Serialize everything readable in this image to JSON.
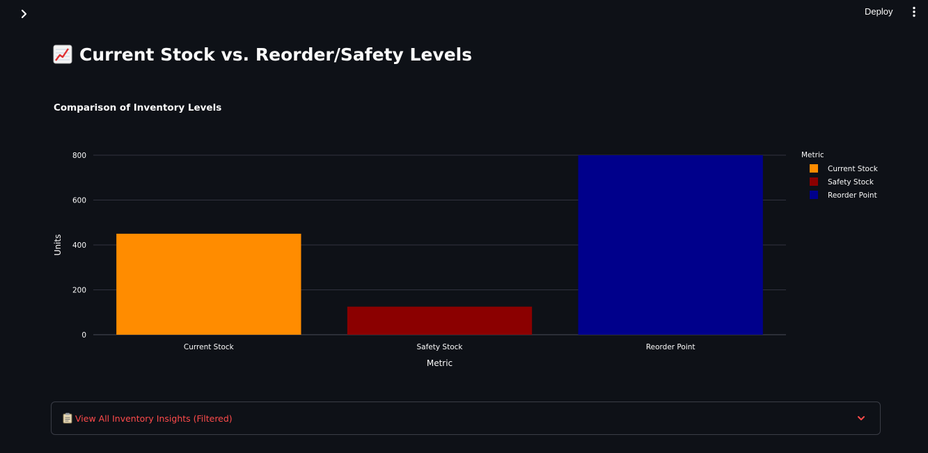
{
  "header": {
    "deploy_label": "Deploy"
  },
  "page": {
    "title": "Current Stock vs. Reorder/Safety Levels",
    "chart_title": "Comparison of Inventory Levels"
  },
  "chart_data": {
    "type": "bar",
    "title": "Comparison of Inventory Levels",
    "xlabel": "Metric",
    "ylabel": "Units",
    "categories": [
      "Current Stock",
      "Safety Stock",
      "Reorder Point"
    ],
    "values": [
      450,
      125,
      800
    ],
    "colors": [
      "#ff8c00",
      "#8b0000",
      "#00008b"
    ],
    "ylim": [
      0,
      800
    ],
    "yticks": [
      0,
      200,
      400,
      600,
      800
    ],
    "grid": true,
    "legend": {
      "title": "Metric",
      "placement": "right",
      "entries": [
        "Current Stock",
        "Safety Stock",
        "Reorder Point"
      ]
    }
  },
  "expander": {
    "label": "View All Inventory Insights (Filtered)",
    "icon": "clipboard-icon"
  },
  "colors": {
    "background": "#0e1117",
    "accent": "#ff4b4b",
    "grid": "#31333f"
  }
}
